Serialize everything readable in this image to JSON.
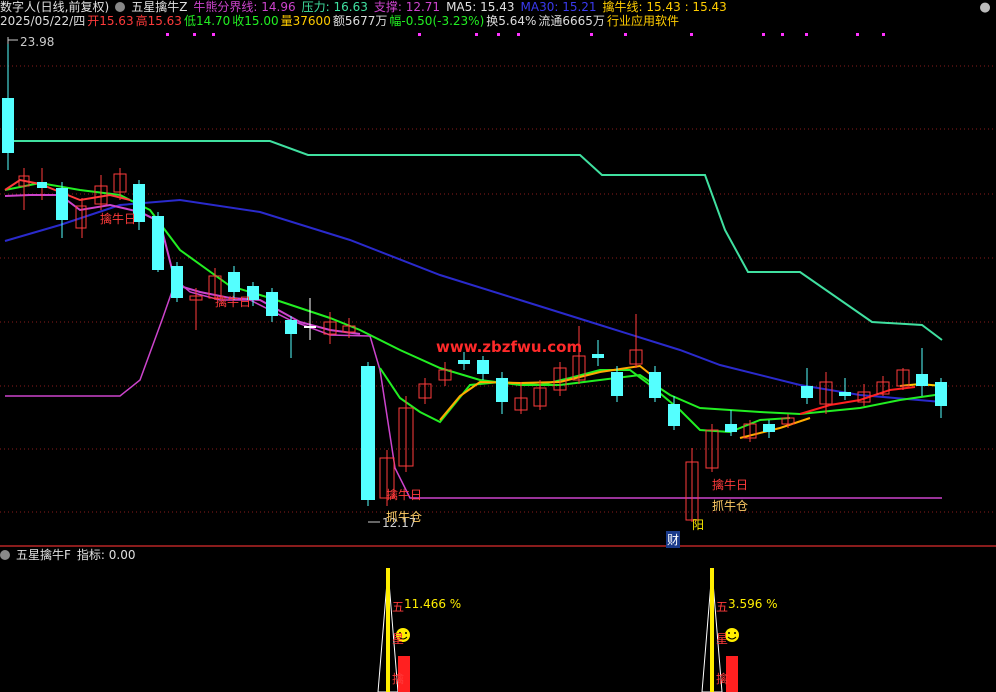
{
  "header": {
    "title": "数字人(日线,前复权)",
    "indicator_name": "五星擒牛Z",
    "ratio_label": "牛熊分界线: 14.96",
    "pressure": "压力: 16.63",
    "support": "支撑: 12.71",
    "ma5": "MA5: 15.43",
    "ma30": "MA30: 15.21",
    "catch_line": "擒牛线: 15.43 : 15.43",
    "date": "2025/05/22/四",
    "open": "开15.63",
    "high": "高15.63",
    "low": "低14.70",
    "close": "收15.00",
    "volume": "量37600",
    "amount": "额5677万",
    "change": "幅-0.50(-3.23%)",
    "turnover": "换5.64%",
    "float": "流通6665万",
    "industry": "行业应用软件"
  },
  "chart": {
    "max_label": "23.98",
    "min_label": "12.17",
    "watermark": "www.zbzfwu.com",
    "labels": {
      "catch_day_1": "擒牛日",
      "catch_day_2": "擒牛日",
      "catch_day_3": "擒牛日",
      "catch_day_4": "擒牛日",
      "grab_pos_1": "抓牛仓",
      "grab_pos_2": "抓牛仓",
      "yang": "阳",
      "cai": "财"
    },
    "colors": {
      "up": "#ff3b3b",
      "down": "#54ffff",
      "ma_green": "#22ee22",
      "ma_blue": "#2a2acc",
      "top_line": "#40e0a0",
      "purple": "#cc44cc"
    }
  },
  "panel2": {
    "indicator_name": "五星擒牛F",
    "value_label": "指标: 0.00",
    "signal_1": "11.466 %",
    "signal_2": "3.596 %",
    "wu": "五",
    "xing": "星",
    "qing": "擒"
  },
  "window": {
    "close_icon": "close-icon"
  }
}
